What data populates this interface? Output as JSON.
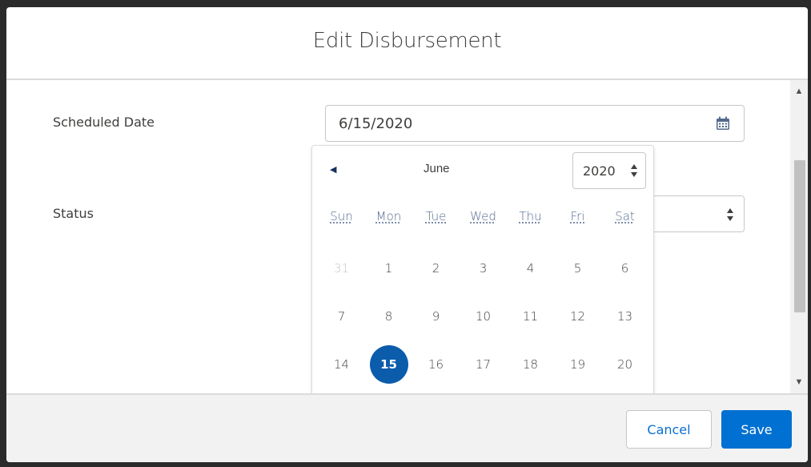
{
  "modal": {
    "title": "Edit Disbursement"
  },
  "form": {
    "scheduled_date_label": "Scheduled Date",
    "scheduled_date_value": "6/15/2020",
    "status_label": "Status",
    "status_value": ""
  },
  "calendar": {
    "month": "June",
    "year": "2020",
    "weekdays": [
      "Sun",
      "Mon",
      "Tue",
      "Wed",
      "Thu",
      "Fri",
      "Sat"
    ],
    "weeks": [
      [
        "31",
        "1",
        "2",
        "3",
        "4",
        "5",
        "6"
      ],
      [
        "7",
        "8",
        "9",
        "10",
        "11",
        "12",
        "13"
      ],
      [
        "14",
        "15",
        "16",
        "17",
        "18",
        "19",
        "20"
      ]
    ],
    "selected_day": "15",
    "adjacent_days": [
      "31"
    ]
  },
  "footer": {
    "cancel_label": "Cancel",
    "save_label": "Save"
  },
  "colors": {
    "brand_blue": "#0070d2",
    "selected_day": "#0b5cab",
    "link_blue": "#0b6fd1"
  },
  "icons": {
    "calendar": "calendar-icon",
    "prev_month": "chevron-left-icon",
    "select": "select-arrows-icon",
    "scroll_up": "scroll-up-arrow-icon",
    "scroll_down": "scroll-down-arrow-icon"
  }
}
